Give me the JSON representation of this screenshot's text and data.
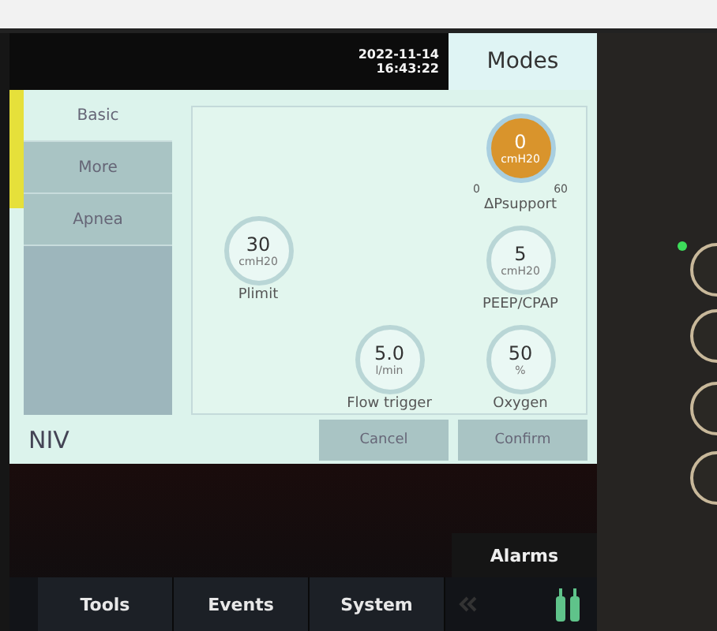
{
  "header": {
    "date": "2022-11-14",
    "time": "16:43:22",
    "tab": {
      "label": "Modes",
      "selected": true
    }
  },
  "sidebar": {
    "items": [
      {
        "label": "Basic",
        "selected": true
      },
      {
        "label": "More",
        "selected": false
      },
      {
        "label": "Apnea",
        "selected": false
      }
    ]
  },
  "dials": [
    {
      "value": "0",
      "unit": "cmH20",
      "label": "ΔPsupport",
      "selected": true,
      "min": "0",
      "max": "60"
    },
    {
      "value": "30",
      "unit": "cmH20",
      "label": "Plimit",
      "selected": false
    },
    {
      "value": "5",
      "unit": "cmH20",
      "label": "PEEP/CPAP",
      "selected": false
    },
    {
      "value": "5.0",
      "unit": "l/min",
      "label": "Flow trigger",
      "selected": false
    },
    {
      "value": "50",
      "unit": "%",
      "label": "Oxygen",
      "selected": false
    }
  ],
  "mode": "NIV",
  "buttons": [
    "Cancel",
    "Confirm"
  ],
  "alarms_tab": "Alarms",
  "nav": [
    "Tools",
    "Events",
    "System"
  ]
}
